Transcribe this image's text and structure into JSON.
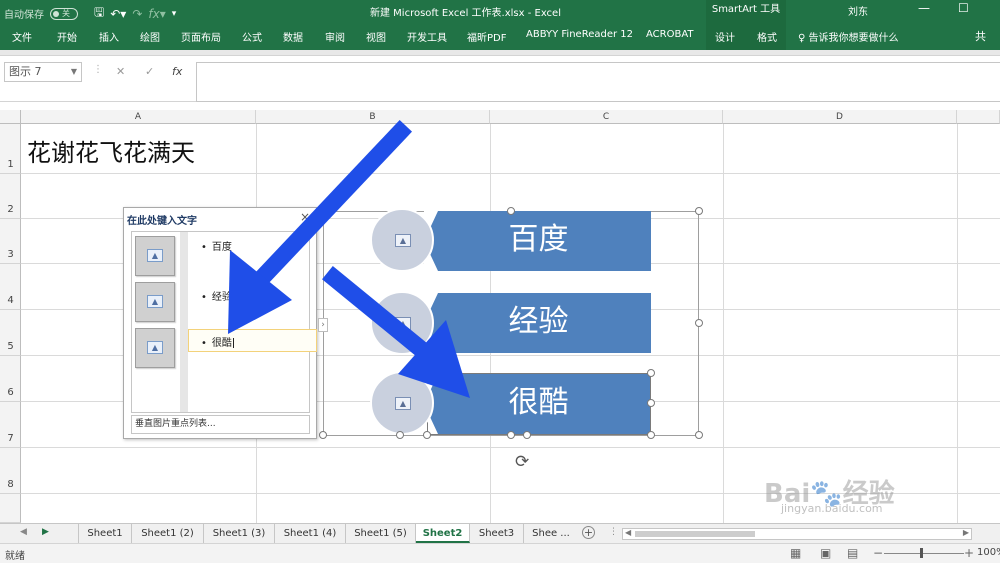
{
  "titlebar": {
    "autosave_label": "自动保存",
    "autosave_state": "关",
    "doc_title": "新建 Microsoft Excel 工作表.xlsx  -  Excel",
    "context_tool": "SmartArt 工具",
    "user": "刘东",
    "minimize": "—",
    "restore": "☐"
  },
  "ribbon": {
    "tabs": [
      "文件",
      "开始",
      "插入",
      "绘图",
      "页面布局",
      "公式",
      "数据",
      "审阅",
      "视图",
      "开发工具",
      "福昕PDF",
      "ABBYY FineReader 12",
      "ACROBAT"
    ],
    "context_tabs": [
      "设计",
      "格式"
    ],
    "tell_me": "♀ 告诉我你想要做什么",
    "share": "共"
  },
  "formula_bar": {
    "name_box": "图示 7",
    "cancel": "✕",
    "enter": "✓",
    "fx": "fx",
    "value": ""
  },
  "columns": [
    "A",
    "B",
    "C",
    "D"
  ],
  "rows": [
    "1",
    "2",
    "3",
    "4",
    "5",
    "6",
    "7",
    "8"
  ],
  "cells": {
    "A1": "花谢花飞花满天"
  },
  "text_pane": {
    "title": "在此处键入文字",
    "close": "×",
    "items": [
      "百度",
      "经验",
      "很酷"
    ],
    "footer": "垂直图片重点列表..."
  },
  "smartart": {
    "items": [
      "百度",
      "经验",
      "很酷"
    ],
    "fill_color": "#4f81bd",
    "circle_color": "#c9d0de"
  },
  "sheets": {
    "tabs": [
      "Sheet1",
      "Sheet1 (2)",
      "Sheet1 (3)",
      "Sheet1 (4)",
      "Sheet1 (5)",
      "Sheet2",
      "Sheet3",
      "Shee ..."
    ],
    "active": "Sheet2",
    "add": "+"
  },
  "status": {
    "ready": "就绪",
    "zoom": "100%"
  },
  "watermark": {
    "text": "Bai🐾经验",
    "url": "jingyan.baidu.com"
  },
  "accent": "#217346",
  "arrow_color": "#1f4ee8"
}
